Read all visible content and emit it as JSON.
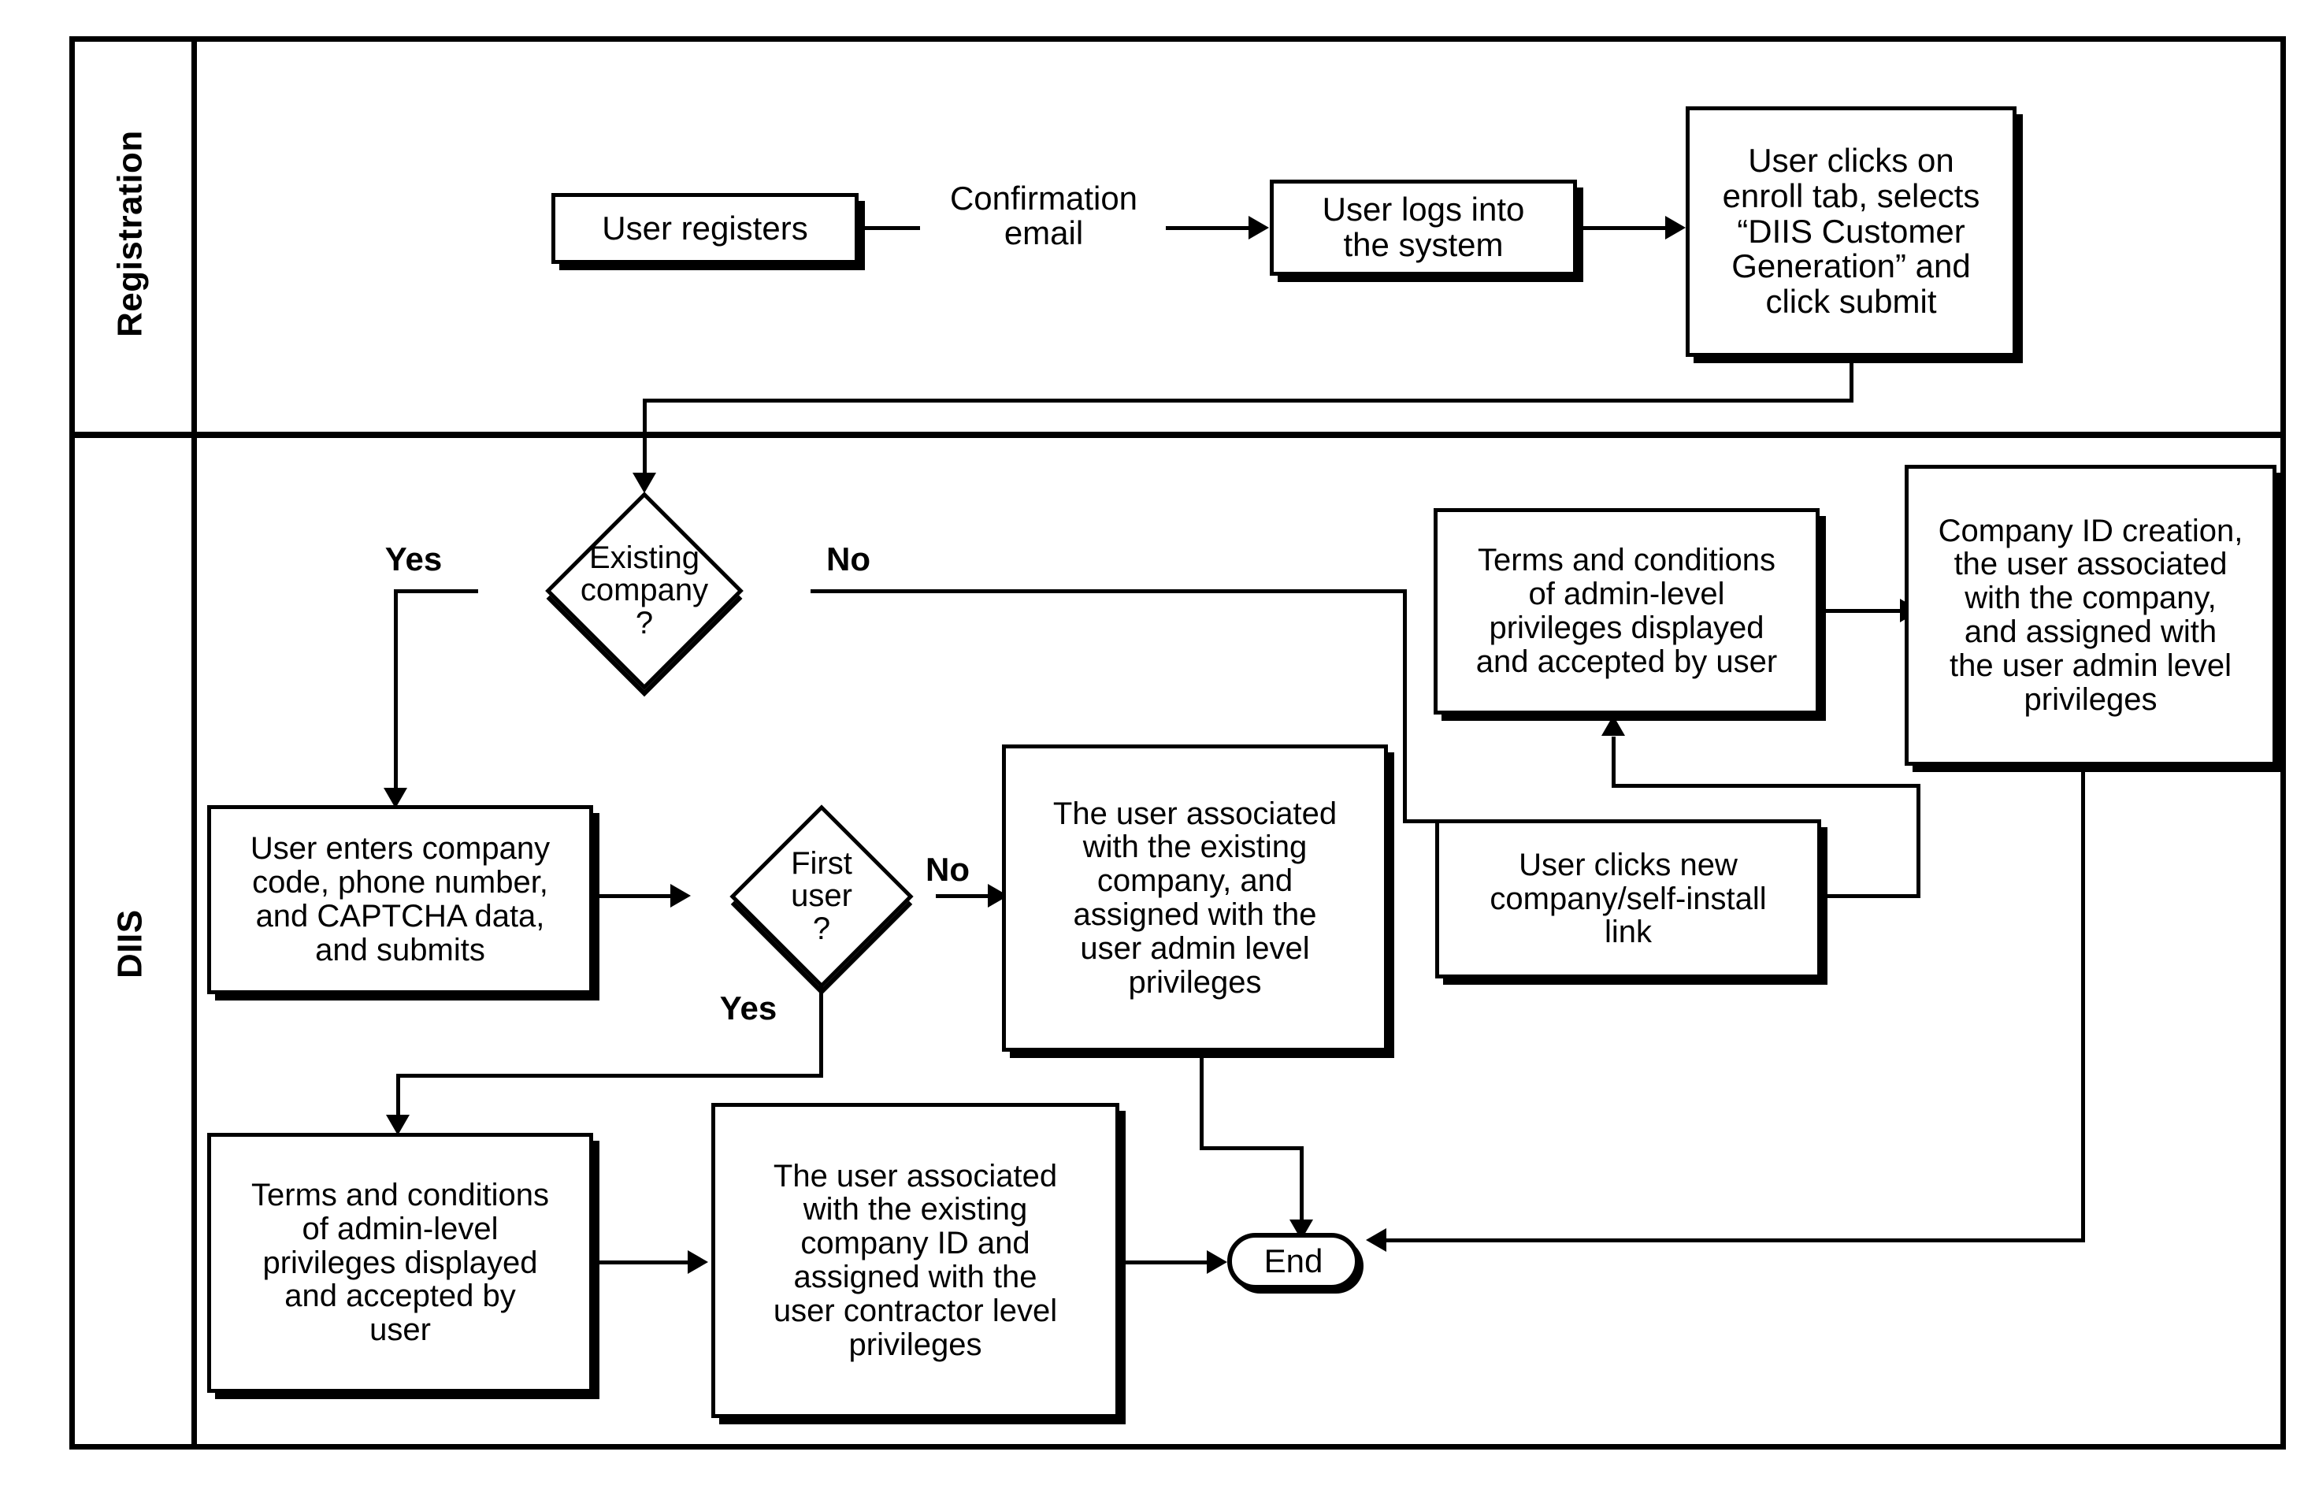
{
  "diagram": {
    "type": "swimlane-flowchart",
    "lanes": [
      {
        "id": "registration",
        "label": "Registration"
      },
      {
        "id": "diis",
        "label": "DIIS"
      }
    ],
    "nodes": [
      {
        "id": "user-registers",
        "shape": "process",
        "lane": "registration",
        "text": "User registers"
      },
      {
        "id": "user-logs-in",
        "shape": "process",
        "lane": "registration",
        "text": "User logs into\nthe system"
      },
      {
        "id": "enroll-tab",
        "shape": "process",
        "lane": "registration",
        "text": "User clicks on\nenroll tab, selects\n“DIIS Customer\nGeneration” and\nclick submit"
      },
      {
        "id": "existing-company",
        "shape": "decision",
        "lane": "diis",
        "text": "Existing\ncompany\n?"
      },
      {
        "id": "enter-company-code",
        "shape": "process",
        "lane": "diis",
        "text": "User enters company\ncode, phone number,\nand CAPTCHA data,\nand submits"
      },
      {
        "id": "first-user",
        "shape": "decision",
        "lane": "diis",
        "text": "First\nuser\n?"
      },
      {
        "id": "assoc-admin",
        "shape": "process",
        "lane": "diis",
        "text": "The user associated\nwith the existing\ncompany, and\nassigned with the\nuser admin level\nprivileges"
      },
      {
        "id": "terms-right",
        "shape": "process",
        "lane": "diis",
        "text": "Terms and conditions\nof admin-level\nprivileges displayed\nand accepted by user"
      },
      {
        "id": "company-id-creation",
        "shape": "process",
        "lane": "diis",
        "text": "Company ID creation,\nthe user associated\nwith the company,\nand assigned with\nthe user admin level\nprivileges"
      },
      {
        "id": "new-company-link",
        "shape": "process",
        "lane": "diis",
        "text": "User clicks new\ncompany/self-install\nlink"
      },
      {
        "id": "terms-left",
        "shape": "process",
        "lane": "diis",
        "text": "Terms and conditions\nof admin-level\nprivileges displayed\nand accepted by\nuser"
      },
      {
        "id": "assoc-contractor",
        "shape": "process",
        "lane": "diis",
        "text": "The user associated\nwith the existing\ncompany ID and\nassigned with the\nuser contractor level\nprivileges"
      },
      {
        "id": "end",
        "shape": "terminator",
        "lane": "diis",
        "text": "End"
      }
    ],
    "edge_labels": {
      "confirmation_email": "Confirmation\nemail",
      "existing_company_yes": "Yes",
      "existing_company_no": "No",
      "first_user_yes": "Yes",
      "first_user_no": "No"
    },
    "colors": {
      "stroke": "#000000",
      "fill": "#ffffff",
      "background": "#ffffff"
    }
  }
}
